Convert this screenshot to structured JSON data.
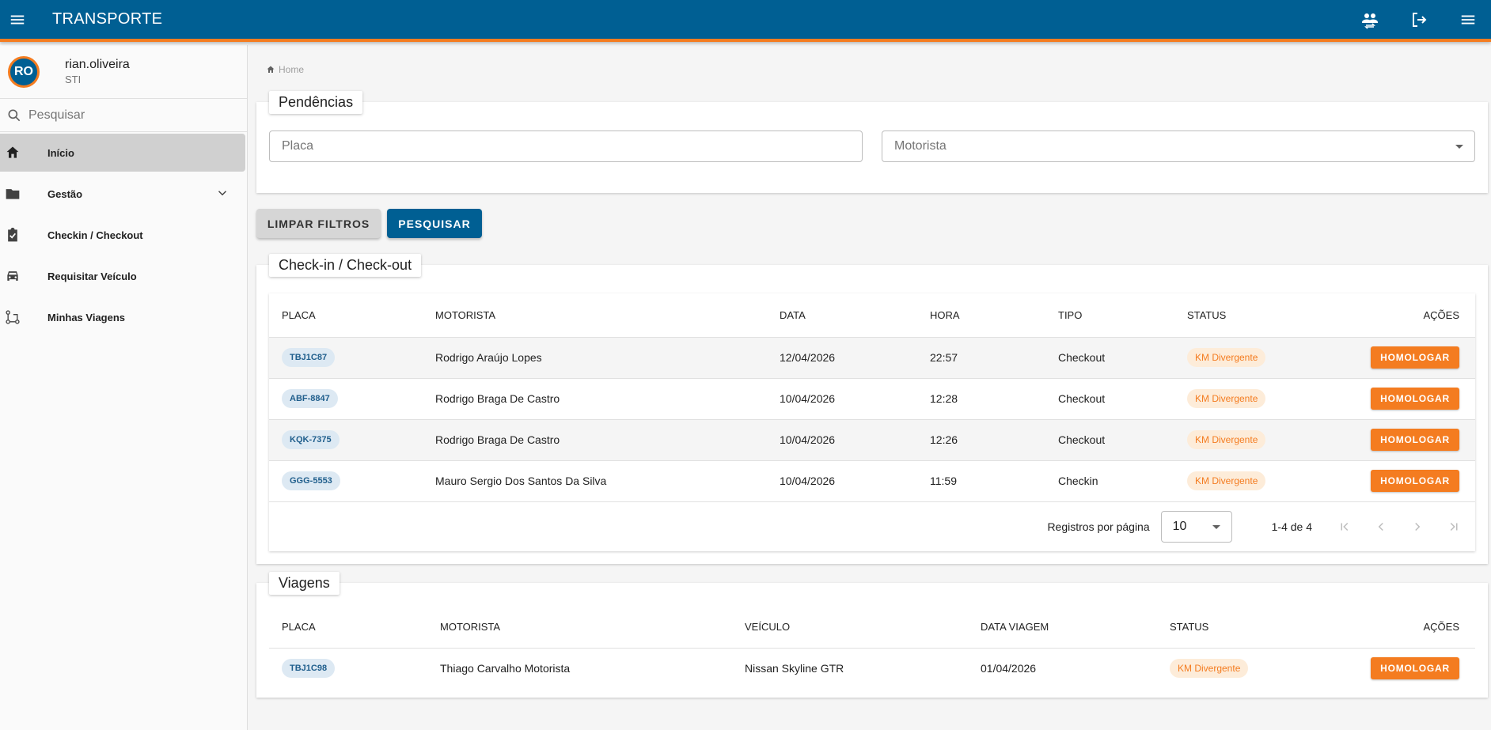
{
  "app": {
    "title": "TRANSPORTE"
  },
  "user": {
    "initials": "RO",
    "name": "rian.oliveira",
    "dept": "STI"
  },
  "sidebar": {
    "search_placeholder": "Pesquisar",
    "items": [
      {
        "label": "Início",
        "icon": "home-icon"
      },
      {
        "label": "Gestão",
        "icon": "folder-icon"
      },
      {
        "label": "Checkin / Checkout",
        "icon": "clipboard-check-icon"
      },
      {
        "label": "Requisitar Veículo",
        "icon": "car-icon"
      },
      {
        "label": "Minhas Viagens",
        "icon": "route-icon"
      }
    ]
  },
  "breadcrumb": {
    "home": "Home"
  },
  "pendencias": {
    "title": "Pendências",
    "placa_placeholder": "Placa",
    "motorista_placeholder": "Motorista",
    "clear_label": "LIMPAR FILTROS",
    "search_label": "PESQUISAR"
  },
  "checkin": {
    "title": "Check-in / Check-out",
    "headers": {
      "placa": "PLACA",
      "motorista": "MOTORISTA",
      "data": "DATA",
      "hora": "HORA",
      "tipo": "TIPO",
      "status": "STATUS",
      "acoes": "AÇÕES"
    },
    "rows": [
      {
        "placa": "TBJ1C87",
        "motorista": "Rodrigo Araújo Lopes",
        "data": "12/04/2026",
        "hora": "22:57",
        "tipo": "Checkout",
        "status": "KM Divergente",
        "acao": "HOMOLOGAR"
      },
      {
        "placa": "ABF-8847",
        "motorista": "Rodrigo Braga De Castro",
        "data": "10/04/2026",
        "hora": "12:28",
        "tipo": "Checkout",
        "status": "KM Divergente",
        "acao": "HOMOLOGAR"
      },
      {
        "placa": "KQK-7375",
        "motorista": "Rodrigo Braga De Castro",
        "data": "10/04/2026",
        "hora": "12:26",
        "tipo": "Checkout",
        "status": "KM Divergente",
        "acao": "HOMOLOGAR"
      },
      {
        "placa": "GGG-5553",
        "motorista": "Mauro Sergio Dos Santos Da Silva",
        "data": "10/04/2026",
        "hora": "11:59",
        "tipo": "Checkin",
        "status": "KM Divergente",
        "acao": "HOMOLOGAR"
      }
    ],
    "pager": {
      "label": "Registros por página",
      "page_size": "10",
      "range": "1-4 de 4"
    }
  },
  "viagens": {
    "title": "Viagens",
    "headers": {
      "placa": "PLACA",
      "motorista": "MOTORISTA",
      "veiculo": "VEÍCULO",
      "data": "DATA VIAGEM",
      "status": "STATUS",
      "acoes": "AÇÕES"
    },
    "rows": [
      {
        "placa": "TBJ1C98",
        "motorista": "Thiago Carvalho Motorista",
        "veiculo": "Nissan Skyline GTR",
        "data": "01/04/2026",
        "status": "KM Divergente",
        "acao": "HOMOLOGAR"
      }
    ]
  },
  "colors": {
    "primary": "#005f93",
    "accent": "#f47c20"
  }
}
